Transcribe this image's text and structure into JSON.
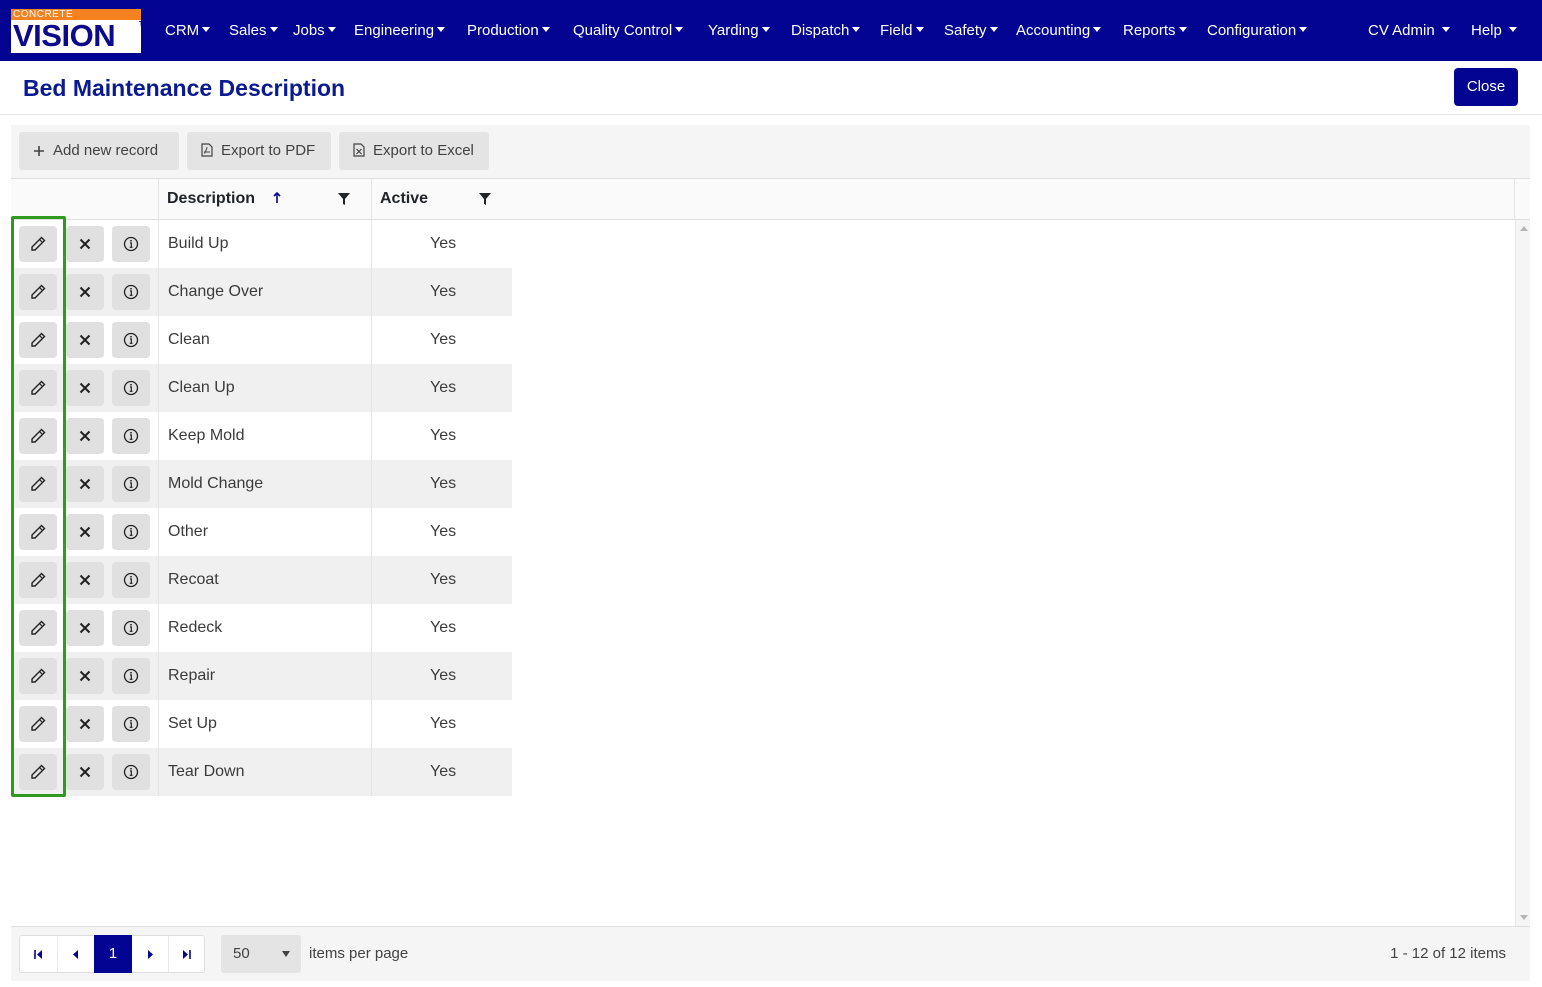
{
  "logo": {
    "small_text": "CONCRETE",
    "main_text": "VISION",
    "tm": "TM"
  },
  "nav": {
    "items": [
      {
        "label": "CRM"
      },
      {
        "label": "Sales"
      },
      {
        "label": "Jobs"
      },
      {
        "label": "Engineering"
      },
      {
        "label": "Production"
      },
      {
        "label": "Quality Control"
      },
      {
        "label": "Yarding"
      },
      {
        "label": "Dispatch"
      },
      {
        "label": "Field"
      },
      {
        "label": "Safety"
      },
      {
        "label": "Accounting"
      },
      {
        "label": "Reports"
      },
      {
        "label": "Configuration"
      }
    ],
    "user": "CV Admin",
    "help": "Help"
  },
  "header": {
    "title": "Bed Maintenance Description",
    "close_label": "Close"
  },
  "toolbar": {
    "add_label": "Add new record",
    "pdf_label": "Export to PDF",
    "excel_label": "Export to Excel"
  },
  "columns": {
    "description": "Description",
    "active": "Active",
    "sort": "ascending"
  },
  "rows": [
    {
      "description": "Build Up",
      "active": "Yes"
    },
    {
      "description": "Change Over",
      "active": "Yes"
    },
    {
      "description": "Clean",
      "active": "Yes"
    },
    {
      "description": "Clean Up",
      "active": "Yes"
    },
    {
      "description": "Keep Mold",
      "active": "Yes"
    },
    {
      "description": "Mold Change",
      "active": "Yes"
    },
    {
      "description": "Other",
      "active": "Yes"
    },
    {
      "description": "Recoat",
      "active": "Yes"
    },
    {
      "description": "Redeck",
      "active": "Yes"
    },
    {
      "description": "Repair",
      "active": "Yes"
    },
    {
      "description": "Set Up",
      "active": "Yes"
    },
    {
      "description": "Tear Down",
      "active": "Yes"
    }
  ],
  "pager": {
    "current_page": "1",
    "page_size": "50",
    "items_label": "items per page",
    "info": "1 - 12 of 12 items"
  },
  "colors": {
    "navbar": "#040493",
    "title": "#0a1a8f",
    "highlight": "#2e9b1f",
    "logo_orange": "#f5821f"
  },
  "icons": [
    "pencil-icon",
    "close-icon",
    "info-icon",
    "plus-icon",
    "pdf-icon",
    "excel-icon",
    "filter-icon",
    "sort-up-icon"
  ]
}
